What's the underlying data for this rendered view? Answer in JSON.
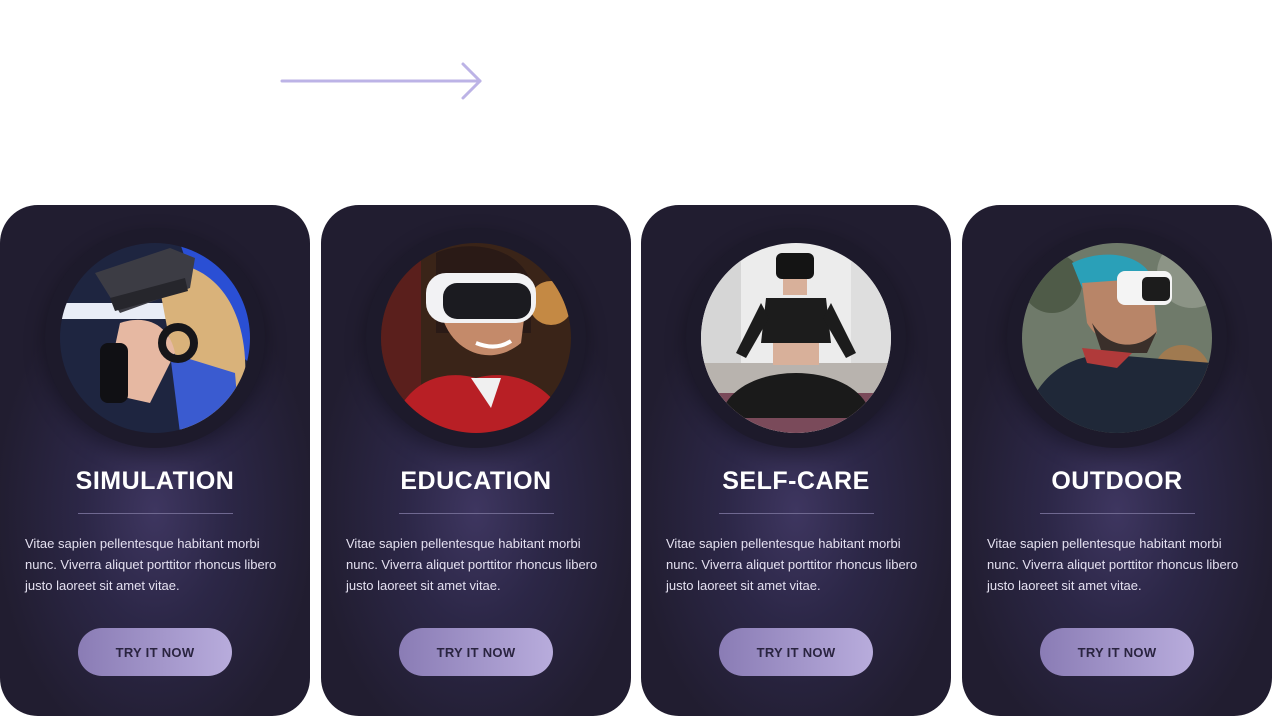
{
  "accent_color": "#bcb3e6",
  "nav": {
    "next_icon": "arrow-right-icon"
  },
  "cards": [
    {
      "title": "SIMULATION",
      "description": "Vitae sapien pellentesque habitant morbi nunc. Viverra aliquet  porttitor rhoncus libero justo laoreet sit amet vitae.",
      "button_label": "TRY IT NOW",
      "image": "person-with-vr-headset-and-controller"
    },
    {
      "title": "EDUCATION",
      "description": "Vitae sapien pellentesque habitant morbi nunc. Viverra aliquet  porttitor rhoncus libero justo laoreet sit amet vitae.",
      "button_label": "TRY IT NOW",
      "image": "smiling-teen-with-vr-headset"
    },
    {
      "title": "SELF-CARE",
      "description": "Vitae sapien pellentesque habitant morbi nunc. Viverra aliquet  porttitor rhoncus libero justo laoreet sit amet vitae.",
      "button_label": "TRY IT NOW",
      "image": "woman-meditating-with-vr-headset"
    },
    {
      "title": "OUTDOOR",
      "description": "Vitae sapien pellentesque habitant morbi nunc. Viverra aliquet  porttitor rhoncus libero justo laoreet sit amet vitae.",
      "button_label": "TRY IT NOW",
      "image": "man-outdoors-with-vr-headset"
    }
  ]
}
